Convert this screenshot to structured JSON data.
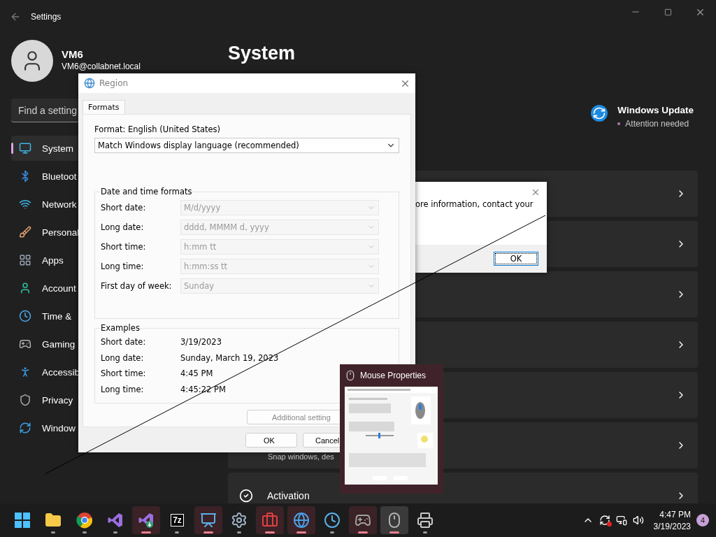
{
  "window": {
    "title": "Settings"
  },
  "account": {
    "name": "VM6",
    "email": "VM6@collabnet.local"
  },
  "search": {
    "placeholder": "Find a setting"
  },
  "nav": [
    {
      "label": "System",
      "selected": true
    },
    {
      "label": "Bluetoot",
      "selected": false
    },
    {
      "label": "Network",
      "selected": false
    },
    {
      "label": "Personal",
      "selected": false
    },
    {
      "label": "Apps",
      "selected": false
    },
    {
      "label": "Account",
      "selected": false
    },
    {
      "label": "Time &",
      "selected": false
    },
    {
      "label": "Gaming",
      "selected": false
    },
    {
      "label": "Accessib",
      "selected": false
    },
    {
      "label": "Privacy",
      "selected": false
    },
    {
      "label": "Window",
      "selected": false
    }
  ],
  "page": {
    "heading": "System",
    "update": {
      "title": "Windows Update",
      "status": "Attention needed"
    }
  },
  "cards": [
    {
      "kind": "blank"
    },
    {
      "kind": "blank"
    },
    {
      "kind": "blank"
    },
    {
      "kind": "blank"
    },
    {
      "kind": "blank"
    },
    {
      "kind": "partial",
      "subtitle": "Snap windows, des"
    },
    {
      "kind": "activation",
      "title": "Activation"
    }
  ],
  "region_dialog": {
    "title": "Region",
    "tabs": [
      {
        "label": "Formats",
        "selected": true
      }
    ],
    "format_label": "Format: English (United States)",
    "format_value": "Match Windows display language (recommended)",
    "formats_group": {
      "title": "Date and time formats",
      "rows": [
        {
          "label": "Short date:",
          "value": "M/d/yyyy",
          "disabled": true
        },
        {
          "label": "Long date:",
          "value": "dddd, MMMM d, yyyy",
          "disabled": true
        },
        {
          "label": "Short time:",
          "value": "h:mm tt",
          "disabled": true
        },
        {
          "label": "Long time:",
          "value": "h:mm:ss tt",
          "disabled": true
        },
        {
          "label": "First day of week:",
          "value": "Sunday",
          "disabled": true
        }
      ]
    },
    "examples": {
      "title": "Examples",
      "rows": [
        {
          "label": "Short date:",
          "value": "3/19/2023"
        },
        {
          "label": "Long date:",
          "value": "Sunday, March 19, 2023"
        },
        {
          "label": "Short time:",
          "value": "4:45 PM"
        },
        {
          "label": "Long time:",
          "value": "4:45:22 PM"
        }
      ]
    },
    "additional_button": "Additional setting",
    "buttons": [
      "OK",
      "Cancel"
    ]
  },
  "message_box": {
    "text": "ore information, contact your",
    "button": "OK"
  },
  "thumbnail": {
    "title": "Mouse Properties"
  },
  "taskbar": {
    "apps": [
      {
        "open": false,
        "attention": false,
        "selected": false
      },
      {
        "open": true,
        "attention": false,
        "selected": false
      },
      {
        "open": true,
        "attention": false,
        "selected": false
      },
      {
        "open": true,
        "attention": false,
        "selected": false
      },
      {
        "open": true,
        "attention": true,
        "selected": false
      },
      {
        "open": true,
        "attention": false,
        "selected": false,
        "glyph": "7z"
      },
      {
        "open": true,
        "attention": true,
        "selected": false
      },
      {
        "open": true,
        "attention": false,
        "selected": false
      },
      {
        "open": true,
        "attention": true,
        "selected": false
      },
      {
        "open": true,
        "attention": true,
        "selected": false
      },
      {
        "open": true,
        "attention": false,
        "selected": false
      },
      {
        "open": true,
        "attention": true,
        "selected": false
      },
      {
        "open": true,
        "attention": true,
        "selected": true
      },
      {
        "open": true,
        "attention": false,
        "selected": false
      }
    ],
    "time": "4:47 PM",
    "date": "3/19/2023",
    "notifications": "4"
  }
}
